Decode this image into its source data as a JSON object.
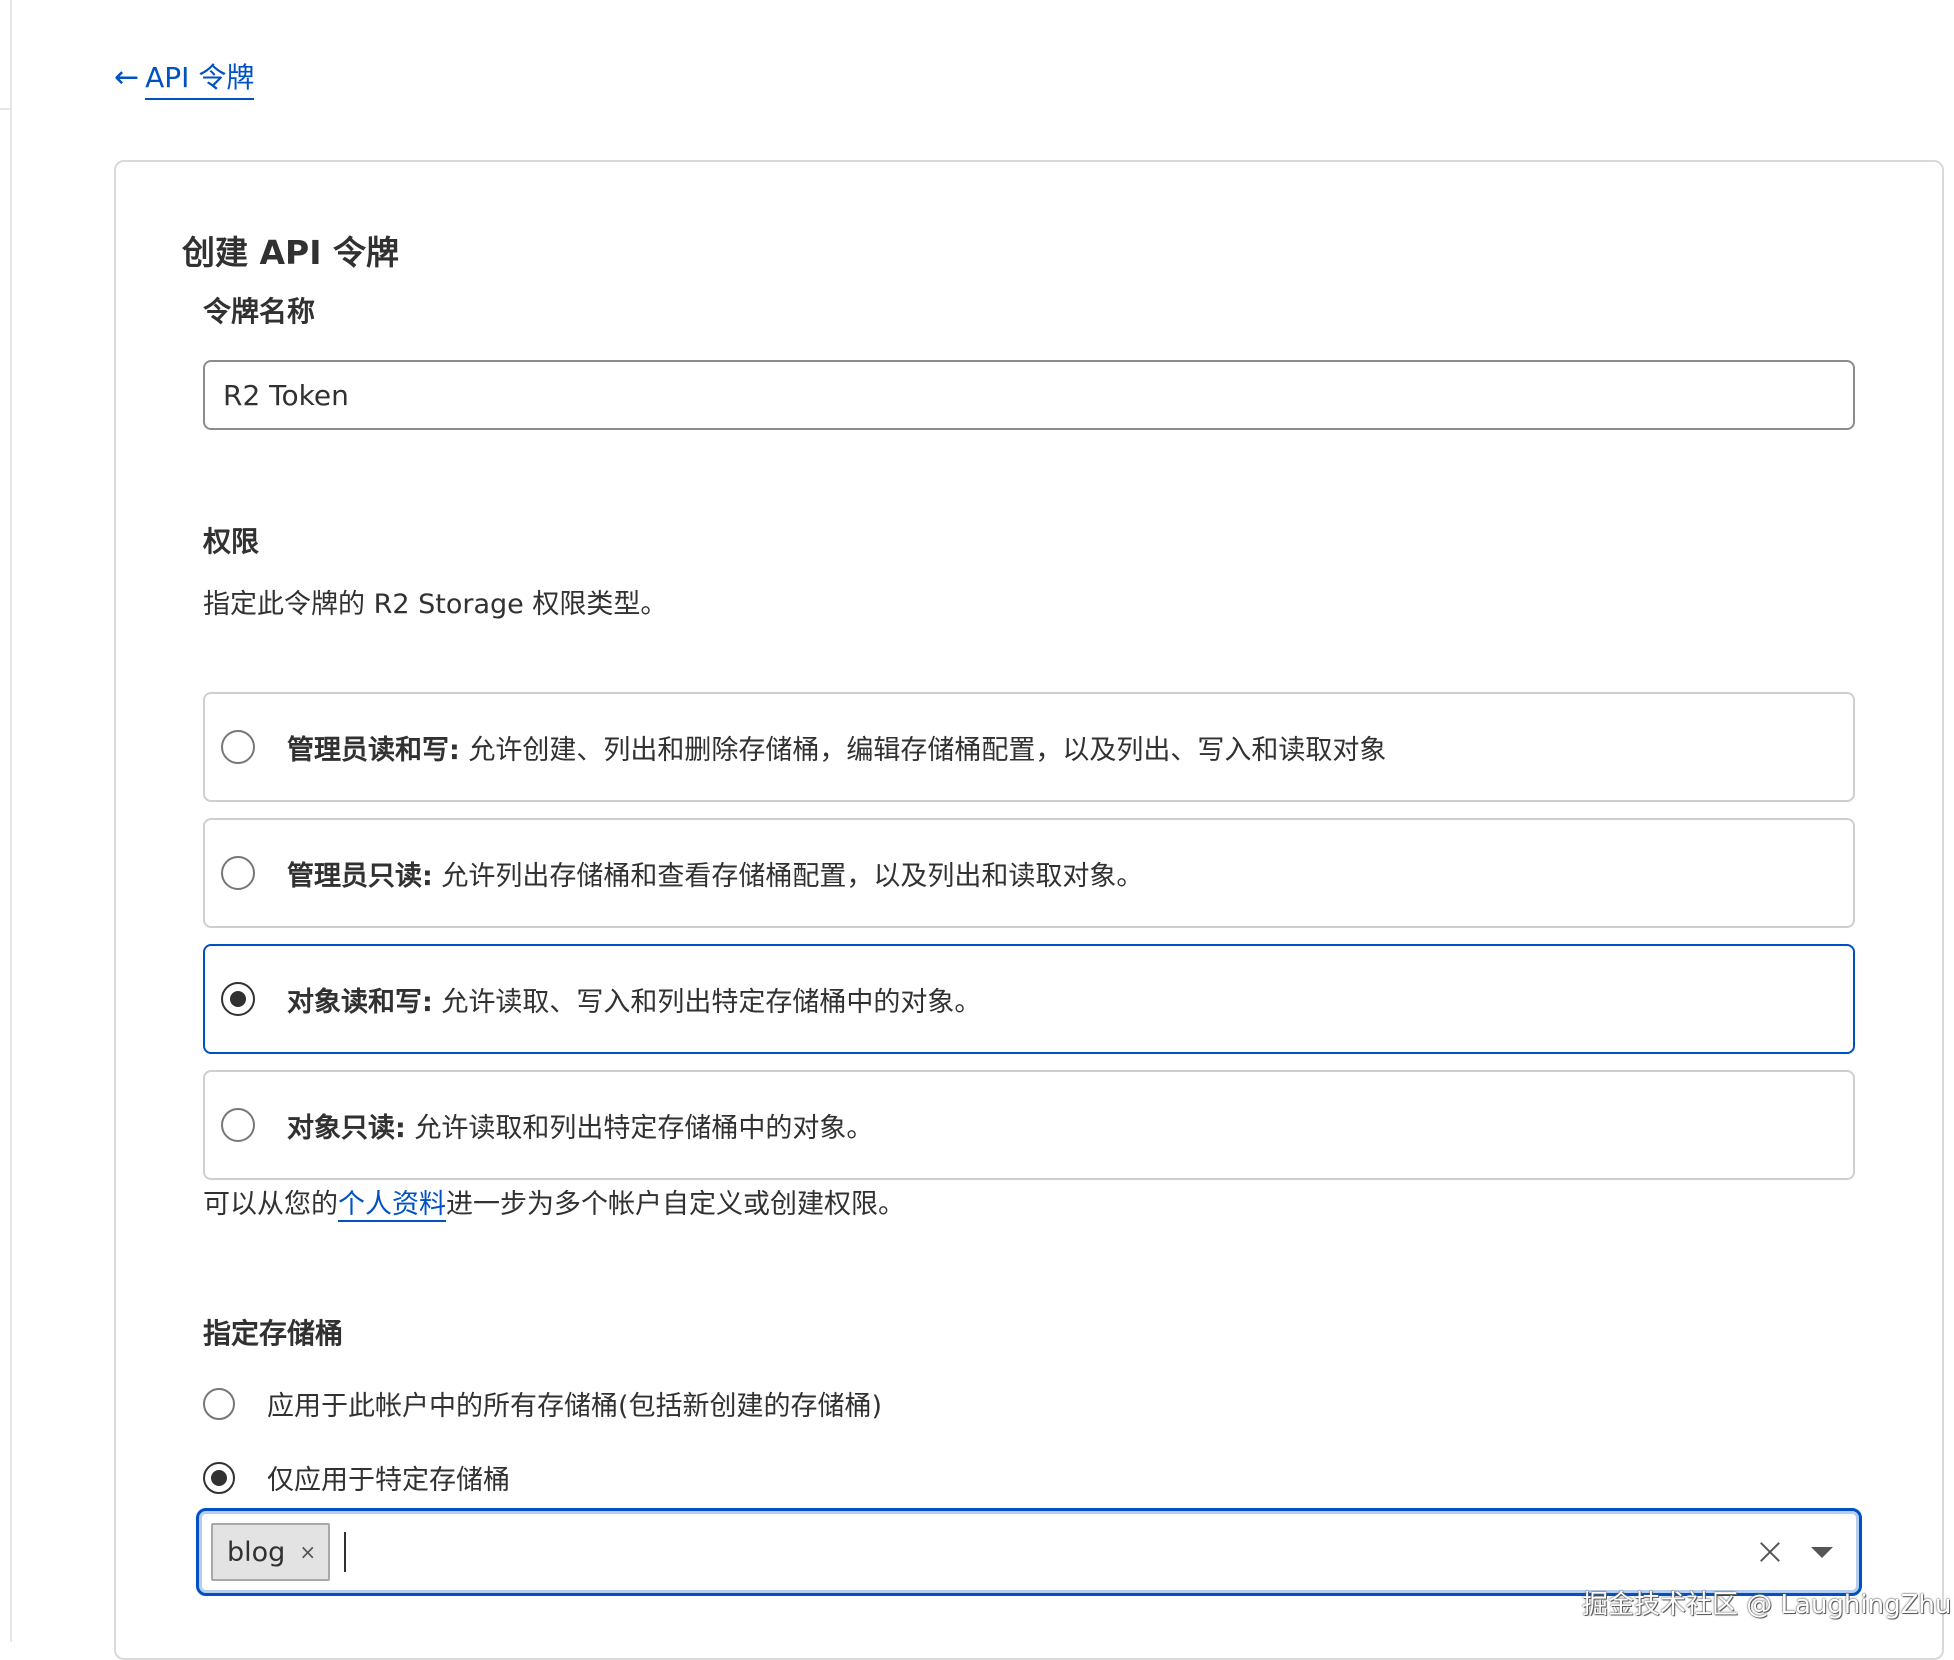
{
  "nav": {
    "back_arrow": "←",
    "back_label": "API 令牌"
  },
  "form": {
    "title": "创建 API 令牌",
    "name_label": "令牌名称",
    "name_value": "R2 Token"
  },
  "permissions": {
    "heading": "权限",
    "description": "指定此令牌的 R2 Storage 权限类型。",
    "options": [
      {
        "title": "管理员读和写:",
        "desc": " 允许创建、列出和删除存储桶，编辑存储桶配置，以及列出、写入和读取对象",
        "selected": false
      },
      {
        "title": "管理员只读:",
        "desc": " 允许列出存储桶和查看存储桶配置，以及列出和读取对象。",
        "selected": false
      },
      {
        "title": "对象读和写:",
        "desc": " 允许读取、写入和列出特定存储桶中的对象。",
        "selected": true
      },
      {
        "title": "对象只读:",
        "desc": " 允许读取和列出特定存储桶中的对象。",
        "selected": false
      }
    ],
    "note_prefix": "可以从您的",
    "note_link": "个人资料",
    "note_suffix": "进一步为多个帐户自定义或创建权限。"
  },
  "buckets": {
    "heading": "指定存储桶",
    "choice_all": "应用于此帐户中的所有存储桶(包括新创建的存储桶)",
    "choice_specific": "仅应用于特定存储桶",
    "selected_choice": "specific",
    "tags": [
      "blog"
    ],
    "tag_remove_glyph": "×"
  },
  "watermark": "掘金技术社区 @ LaughingZhu",
  "colors": {
    "accent": "#0051c3",
    "border": "#cfcfcf",
    "text": "#313131"
  }
}
